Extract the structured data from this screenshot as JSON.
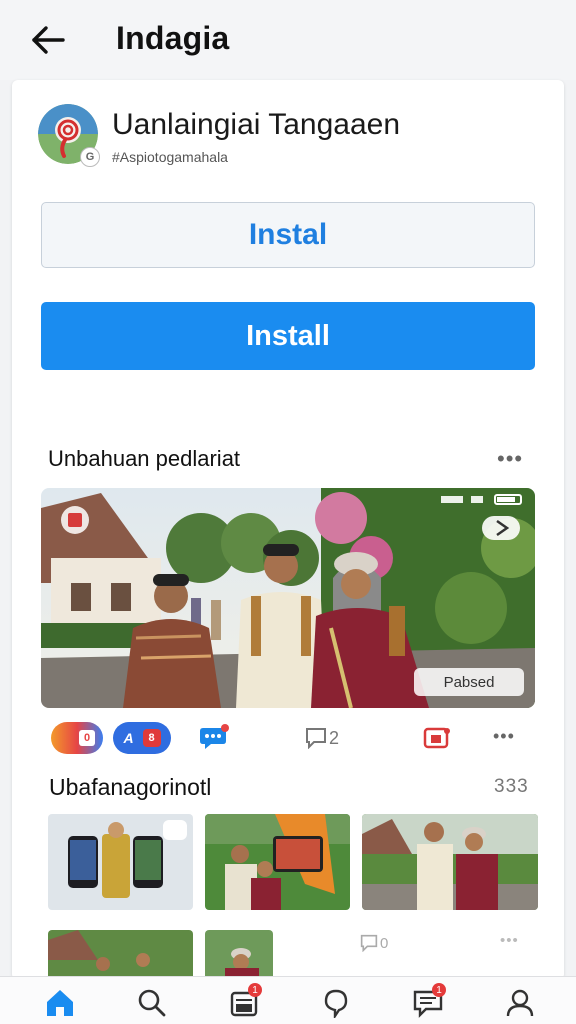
{
  "header": {
    "title": "Indagia",
    "back_icon": "arrow-left-icon"
  },
  "app": {
    "name": "Uanlaingiai Tangaaen",
    "developer": "#Aspiotogamahala",
    "icon": "app-logo-icon",
    "badge": "G"
  },
  "buttons": {
    "secondary_label": "Instal",
    "primary_label": "Install",
    "primary_color": "#1a8cf0"
  },
  "section1": {
    "title": "Unbahuan pedlariat",
    "more": "•••"
  },
  "hero": {
    "caption": "Pabsed",
    "status_icons": "signal-wifi-battery-icons"
  },
  "actions": {
    "chip_a": "0",
    "chip_b": "A",
    "chip_c": "8",
    "comment_count": "2",
    "more": "•••"
  },
  "section2": {
    "title": "Ubafanagorinotl",
    "count": "333"
  },
  "row3": {
    "comment_count": "0",
    "more": "•••"
  },
  "nav": {
    "items": [
      {
        "icon": "home-icon",
        "active": true
      },
      {
        "icon": "search-icon"
      },
      {
        "icon": "inbox-icon",
        "badge": "1"
      },
      {
        "icon": "notification-icon"
      },
      {
        "icon": "messages-icon",
        "badge": "1"
      },
      {
        "icon": "profile-icon"
      }
    ]
  },
  "colors": {
    "accent": "#1a8cf0",
    "badge": "#e43a3a"
  }
}
